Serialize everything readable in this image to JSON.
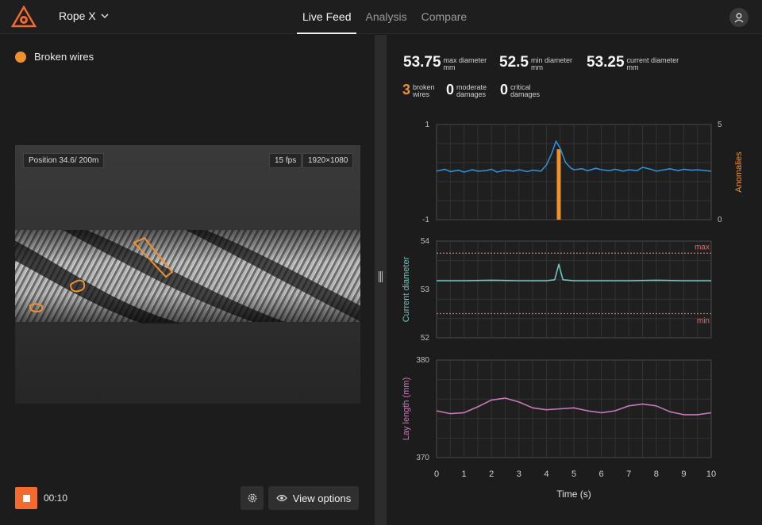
{
  "app": {
    "name": "Rope X"
  },
  "tabs": [
    {
      "label": "Live Feed",
      "active": true
    },
    {
      "label": "Analysis",
      "active": false
    },
    {
      "label": "Compare",
      "active": false
    }
  ],
  "left": {
    "legend_label": "Broken wires",
    "legend_color": "#f0922c",
    "video": {
      "position": "Position 34.6/ 200m",
      "fps": "15 fps",
      "resolution": "1920×1080"
    },
    "timer": "00:10",
    "view_options": "View options"
  },
  "stats": {
    "max_diameter": {
      "value": "53.75",
      "label1": "max diameter",
      "label2": "mm"
    },
    "min_diameter": {
      "value": "52.5",
      "label1": "min diameter",
      "label2": "mm"
    },
    "current_diameter": {
      "value": "53.25",
      "label1": "current diameter",
      "label2": "mm"
    },
    "broken": {
      "value": "3",
      "label1": "broken",
      "label2": "wires"
    },
    "moderate": {
      "value": "0",
      "label1": "moderate",
      "label2": "damages"
    },
    "critical": {
      "value": "0",
      "label1": "critical",
      "label2": "damages"
    }
  },
  "chart_data": [
    {
      "type": "line",
      "ylim": [
        -1,
        1
      ],
      "ylabel": "",
      "y2label": "Anomalies",
      "y2lim": [
        0,
        5
      ],
      "yticks": [
        "1",
        "-1"
      ],
      "y2ticks": [
        "5",
        "0"
      ],
      "series": [
        {
          "x": [
            0,
            0.3,
            0.5,
            0.8,
            1,
            1.3,
            1.5,
            1.8,
            2,
            2.2,
            2.5,
            2.8,
            3,
            3.3,
            3.5,
            3.8,
            4,
            4.2,
            4.35,
            4.5,
            4.7,
            4.9,
            5,
            5.3,
            5.5,
            5.8,
            6,
            6.3,
            6.5,
            6.8,
            7,
            7.3,
            7.5,
            7.8,
            8,
            8.3,
            8.5,
            8.8,
            9,
            9.3,
            9.5,
            9.8,
            10
          ],
          "y": [
            0.02,
            0.06,
            0.01,
            0.04,
            0.0,
            0.05,
            0.02,
            0.03,
            0.06,
            0.0,
            0.04,
            0.02,
            0.05,
            0.01,
            0.04,
            0.02,
            0.15,
            0.4,
            0.65,
            0.5,
            0.2,
            0.08,
            0.05,
            0.07,
            0.03,
            0.08,
            0.05,
            0.03,
            0.06,
            0.02,
            0.05,
            0.03,
            0.1,
            0.06,
            0.02,
            0.05,
            0.07,
            0.03,
            0.06,
            0.04,
            0.05,
            0.03,
            0.02
          ]
        }
      ],
      "bars": [
        {
          "x": 4.45,
          "value": 3.7
        }
      ],
      "line_color": "#2d8fd8",
      "bar_color": "#f0922c"
    },
    {
      "type": "line",
      "ylabel": "Current diameter",
      "ylim": [
        52,
        54
      ],
      "yticks": [
        "54",
        "53",
        "52"
      ],
      "thresholds": [
        {
          "label": "max",
          "value": 53.75
        },
        {
          "label": "min",
          "value": 52.5
        }
      ],
      "series": [
        {
          "x": [
            0,
            1,
            2,
            3,
            4,
            4.3,
            4.45,
            4.6,
            5,
            6,
            7,
            8,
            9,
            10
          ],
          "y": [
            53.18,
            53.18,
            53.19,
            53.18,
            53.18,
            53.2,
            53.52,
            53.2,
            53.18,
            53.18,
            53.18,
            53.19,
            53.18,
            53.18
          ]
        }
      ],
      "line_color": "#6cc5bf",
      "threshold_color": "#e06b6b"
    },
    {
      "type": "line",
      "ylabel": "Lay length (mm)",
      "ylim": [
        370,
        380
      ],
      "yticks": [
        "380",
        "370"
      ],
      "xlabel": "Time (s)",
      "xticks": [
        "0",
        "1",
        "2",
        "3",
        "4",
        "5",
        "6",
        "7",
        "8",
        "9",
        "10"
      ],
      "series": [
        {
          "x": [
            0,
            0.5,
            1,
            1.5,
            2,
            2.5,
            3,
            3.5,
            4,
            4.5,
            5,
            5.5,
            6,
            6.5,
            7,
            7.5,
            8,
            8.5,
            9,
            9.5,
            10
          ],
          "y": [
            374.8,
            374.5,
            374.6,
            375.2,
            375.9,
            376.1,
            375.7,
            375.1,
            374.9,
            375.0,
            375.1,
            374.8,
            374.6,
            374.8,
            375.3,
            375.5,
            375.3,
            374.7,
            374.4,
            374.4,
            374.6
          ]
        }
      ],
      "line_color": "#c67ab8"
    }
  ]
}
